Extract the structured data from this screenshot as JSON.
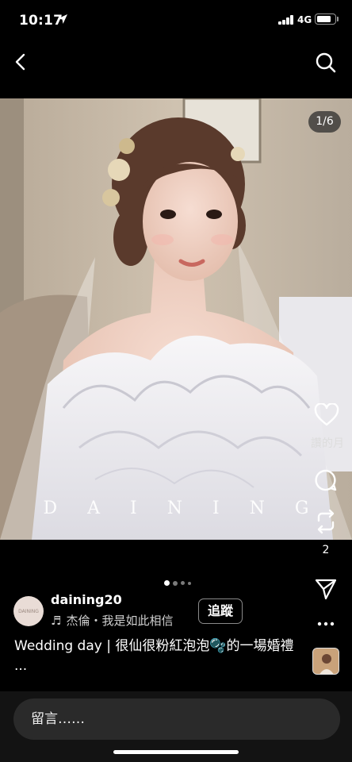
{
  "status_bar": {
    "time": "10:17",
    "network": "4G",
    "battery_level": 0.85
  },
  "nav": {
    "back_icon": "chevron-left-icon",
    "search_icon": "search-icon"
  },
  "post": {
    "photo_counter": "1/6",
    "watermark": "DAINING",
    "carousel": {
      "active_index": 0,
      "dot_count": 4
    },
    "author": {
      "username": "daining20",
      "avatar_text": "DAINING",
      "music": "杰倫・我是如此相信",
      "follow_label": "追蹤"
    },
    "caption": "Wedding day | 很仙很粉紅泡泡🫧的一場婚禮 ...",
    "actions": {
      "like_label": "讚的月",
      "repost_count": "2"
    }
  },
  "comment": {
    "placeholder": "留言……"
  },
  "colors": {
    "background": "#000000",
    "input_background": "#2a2a2a",
    "bottom_bar": "#131313"
  }
}
